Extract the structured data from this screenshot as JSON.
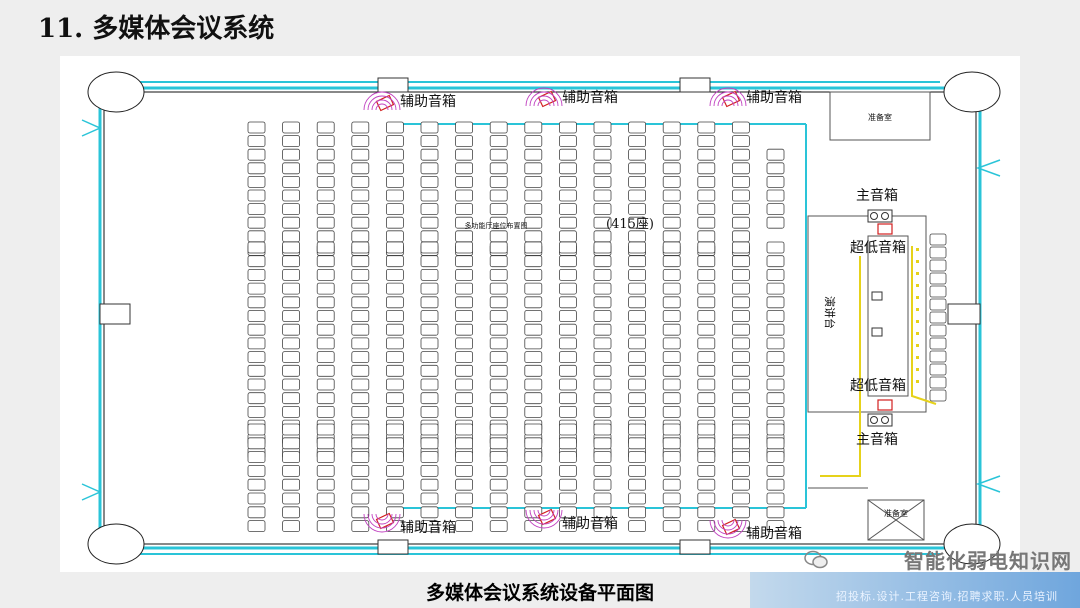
{
  "header": {
    "title": "11. 多媒体会议系统"
  },
  "caption": "多媒体会议系统设备平面图",
  "plan": {
    "aux_speaker_label": "辅助音箱",
    "main_speaker_label": "主音箱",
    "subwoofer_label": "超低音箱",
    "prep_room_label": "准备室",
    "seat_count_label": "(415座)",
    "center_note": "多功能厅座位布置图",
    "stage_label": "演讲台"
  },
  "watermark": {
    "brand": "智能化弱电知识网",
    "sub": "招投标.设计.工程咨询.招聘求职.人员培训"
  },
  "colors": {
    "wall": "#2ac4d8",
    "seat": "#444444",
    "speaker": "#d22020",
    "sound_wave": "#c040c0",
    "cable": "#e6d21a"
  }
}
